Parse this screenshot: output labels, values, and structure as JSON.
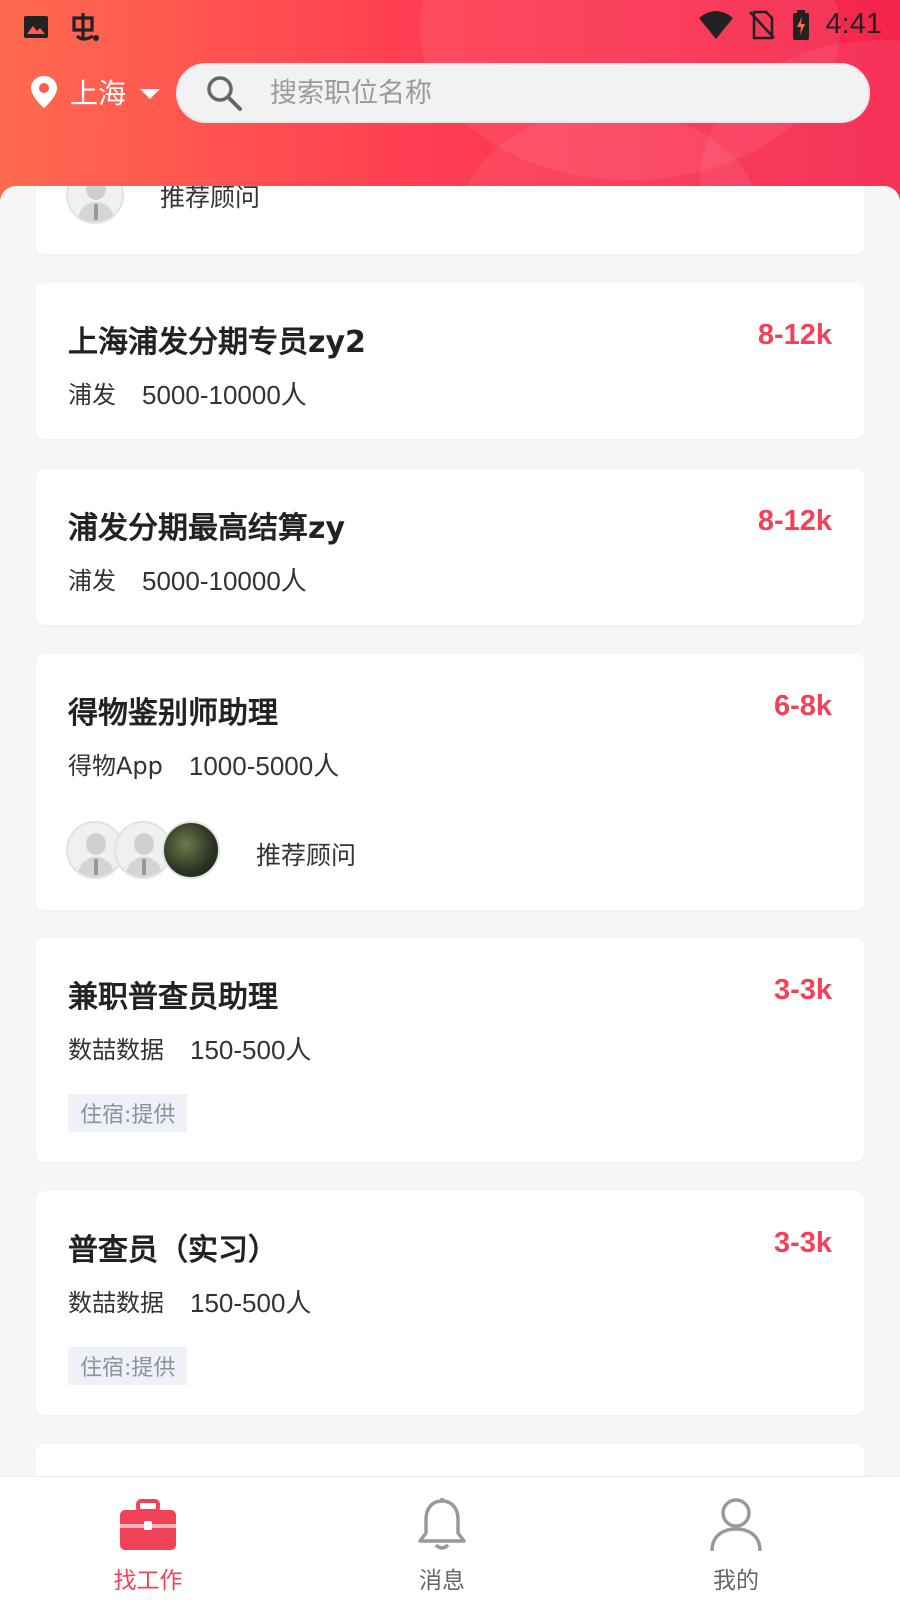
{
  "status_bar": {
    "time": "4:41",
    "left_icons": [
      "image-icon",
      "app-logo-icon"
    ],
    "right_icons": [
      "wifi-icon",
      "no-sim-icon",
      "battery-charging-icon"
    ]
  },
  "header": {
    "city": "上海",
    "search_placeholder": "搜索职位名称"
  },
  "partial_card": {
    "advisor_label": "推荐顾问"
  },
  "jobs": [
    {
      "title": "上海浦发分期专员zy2",
      "salary": "8-12k",
      "company": "浦发",
      "size": "5000-10000人"
    },
    {
      "title": "浦发分期最高结算zy",
      "salary": "8-12k",
      "company": "浦发",
      "size": "5000-10000人"
    },
    {
      "title": "得物鉴别师助理",
      "salary": "6-8k",
      "company": "得物App",
      "size": "1000-5000人",
      "advisor_label": "推荐顾问"
    },
    {
      "title": "兼职普查员助理",
      "salary": "3-3k",
      "company": "数喆数据",
      "size": "150-500人",
      "tag": "住宿:提供"
    },
    {
      "title": "普查员（实习）",
      "salary": "3-3k",
      "company": "数喆数据",
      "size": "150-500人",
      "tag": "住宿:提供"
    }
  ],
  "tabbar": {
    "tabs": [
      {
        "label": "找工作",
        "icon": "briefcase-icon",
        "active": true
      },
      {
        "label": "消息",
        "icon": "bell-icon",
        "active": false
      },
      {
        "label": "我的",
        "icon": "person-icon",
        "active": false
      }
    ]
  },
  "colors": {
    "accent": "#f2425a",
    "header_gradient_start": "#ff6a4f",
    "header_gradient_end": "#f5234d",
    "tag_bg": "#eef1f5"
  }
}
